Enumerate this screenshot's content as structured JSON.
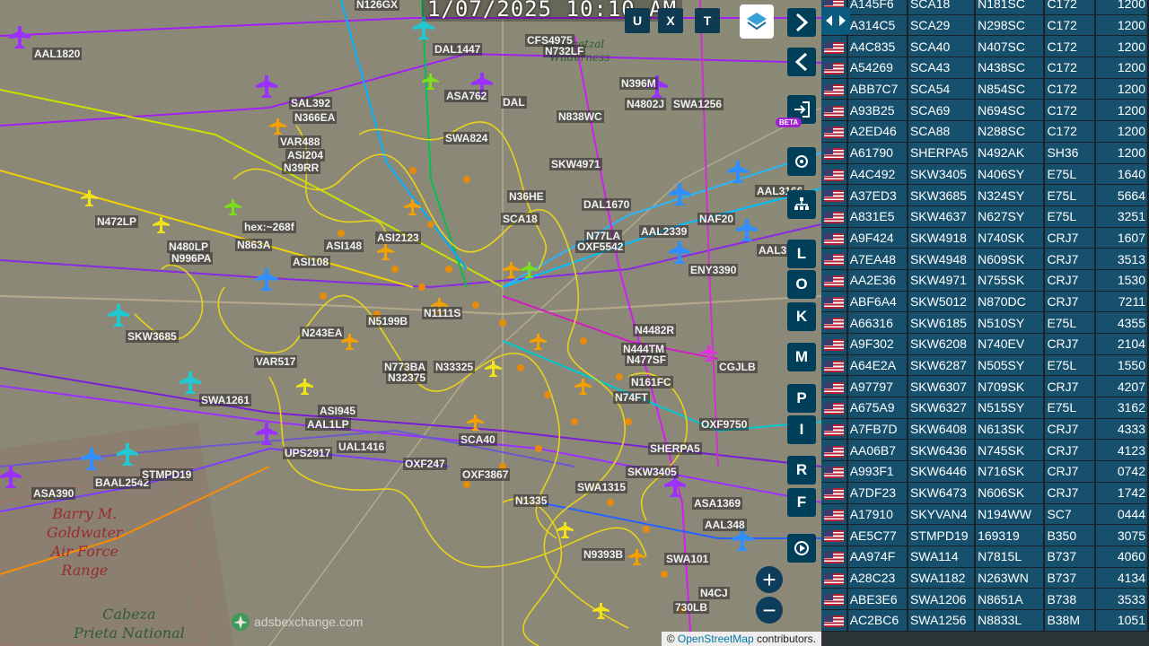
{
  "clock": "1/07/2025 10:10 AM",
  "top_buttons": [
    "U",
    "X",
    "T"
  ],
  "right_buttons": [
    "L",
    "O",
    "K",
    "M",
    "P",
    "I",
    "R",
    "F"
  ],
  "beta": "BETA",
  "zoom": {
    "in": "+",
    "out": "−"
  },
  "logo_text": "adsbexchange.com",
  "attribution": {
    "prefix": "© ",
    "link": "OpenStreetMap",
    "suffix": " contributors."
  },
  "places": {
    "barry": [
      "Barry M.",
      "Goldwater",
      "Air Force",
      "Range"
    ],
    "cabeza": [
      "Cabeza",
      "Prieta National"
    ],
    "mazatzal": [
      "Mazatzal",
      "Wilderness"
    ]
  },
  "callsigns": [
    "N126GX",
    "AAL1820",
    "DAL1447",
    "CFS4975",
    "N732LF",
    "N396M",
    "ASA762",
    "DAL",
    "N4802J",
    "SWA1256",
    "N838WC",
    "SAL392",
    "N366EA",
    "VAR488",
    "ASI204",
    "N39RR",
    "SWA824",
    "SKW4971",
    "AAL3166",
    "N472LP",
    "N36HE",
    "DAL1670",
    "NAF20",
    "N480LP",
    "N996PA",
    "N863A",
    "ASI148",
    "N77LA",
    "AAL2339",
    "OXF5542",
    "AAL3",
    "ASI108",
    "ENY3390",
    "ASI2123",
    "SCA18",
    "SKW3685",
    "N5199B",
    "N1111S",
    "N243EA",
    "N4482R",
    "VAR517",
    "N444TM",
    "N477SF",
    "CGJLB",
    "N773BA",
    "N33325",
    "N32375",
    "SWA1261",
    "N161FC",
    "N74FT",
    "ASI945",
    "AAL1LP",
    "UAL1416",
    "UPS2917",
    "SCA40",
    "SHERPA5",
    "OXF9750",
    "OXF247",
    "OXF3867",
    "SKW3405",
    "SWA1315",
    "ASA1369",
    "ASA390",
    "BAAL2542",
    "STMPD19",
    "N9393B",
    "SWA101",
    "730LB",
    "N4CJ",
    "AAL348",
    "N1335",
    "hex:~268f"
  ],
  "aircraft_list": [
    [
      "A145F6",
      "SCA18",
      "N181SC",
      "C172",
      "1200"
    ],
    [
      "A314C5",
      "SCA29",
      "N298SC",
      "C172",
      "1200"
    ],
    [
      "A4C835",
      "SCA40",
      "N407SC",
      "C172",
      "1200"
    ],
    [
      "A54269",
      "SCA43",
      "N438SC",
      "C172",
      "1200"
    ],
    [
      "ABB7C7",
      "SCA54",
      "N854SC",
      "C172",
      "1200"
    ],
    [
      "A93B25",
      "SCA69",
      "N694SC",
      "C172",
      "1200"
    ],
    [
      "A2ED46",
      "SCA88",
      "N288SC",
      "C172",
      "1200"
    ],
    [
      "A61790",
      "SHERPA5",
      "N492AK",
      "SH36",
      "1200"
    ],
    [
      "A4C492",
      "SKW3405",
      "N406SY",
      "E75L",
      "1640"
    ],
    [
      "A37ED3",
      "SKW3685",
      "N324SY",
      "E75L",
      "5664"
    ],
    [
      "A831E5",
      "SKW4637",
      "N627SY",
      "E75L",
      "3251"
    ],
    [
      "A9F424",
      "SKW4918",
      "N740SK",
      "CRJ7",
      "1607"
    ],
    [
      "A7EA48",
      "SKW4948",
      "N609SK",
      "CRJ7",
      "3513"
    ],
    [
      "AA2E36",
      "SKW4971",
      "N755SK",
      "CRJ7",
      "1530"
    ],
    [
      "ABF6A4",
      "SKW5012",
      "N870DC",
      "CRJ7",
      "7211"
    ],
    [
      "A66316",
      "SKW6185",
      "N510SY",
      "E75L",
      "4355"
    ],
    [
      "A9F302",
      "SKW6208",
      "N740EV",
      "CRJ7",
      "2104"
    ],
    [
      "A64E2A",
      "SKW6287",
      "N505SY",
      "E75L",
      "1550"
    ],
    [
      "A97797",
      "SKW6307",
      "N709SK",
      "CRJ7",
      "4207"
    ],
    [
      "A675A9",
      "SKW6327",
      "N515SY",
      "E75L",
      "3162"
    ],
    [
      "A7FB7D",
      "SKW6408",
      "N613SK",
      "CRJ7",
      "4333"
    ],
    [
      "AA06B7",
      "SKW6436",
      "N745SK",
      "CRJ7",
      "4123"
    ],
    [
      "A993F1",
      "SKW6446",
      "N716SK",
      "CRJ7",
      "0742"
    ],
    [
      "A7DF23",
      "SKW6473",
      "N606SK",
      "CRJ7",
      "1742"
    ],
    [
      "A17910",
      "SKYVAN4",
      "N194WW",
      "SC7",
      "0444"
    ],
    [
      "AE5C77",
      "STMPD19",
      "169319",
      "B350",
      "3075"
    ],
    [
      "AA974F",
      "SWA114",
      "N7815L",
      "B737",
      "4060"
    ],
    [
      "A28C23",
      "SWA1182",
      "N263WN",
      "B737",
      "4134"
    ],
    [
      "ABE3E6",
      "SWA1206",
      "N8651A",
      "B738",
      "3533"
    ],
    [
      "AC2BC6",
      "SWA1256",
      "N8833L",
      "B38M",
      "1051"
    ]
  ],
  "colors": {
    "panel_row": "#17506c",
    "button": "#003f5a",
    "track_yellow": "#e6d31a",
    "track_purple": "#a020f0"
  }
}
